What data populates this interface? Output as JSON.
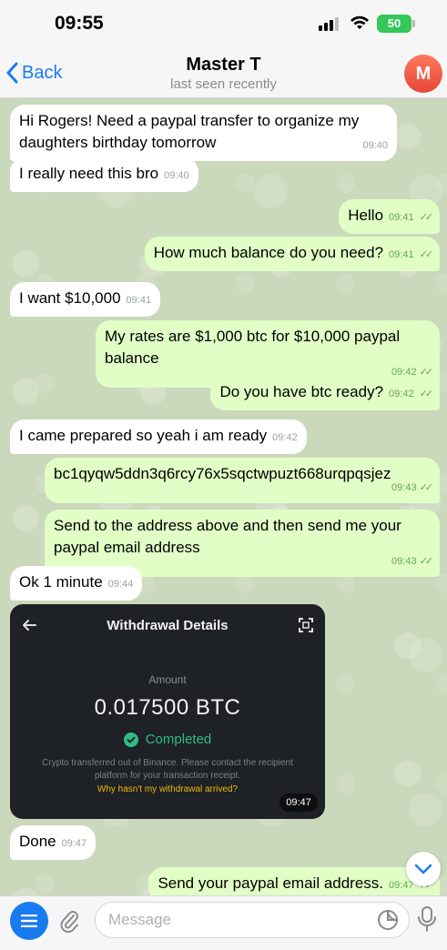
{
  "status_bar": {
    "time": "09:55",
    "battery": "50"
  },
  "header": {
    "back_label": "Back",
    "title": "Master T",
    "subtitle": "last seen recently",
    "avatar_letter": "M"
  },
  "messages": [
    {
      "dir": "in",
      "text": "Hi Rogers! Need a paypal transfer to organize my daughters birthday tomorrow",
      "time": "09:40"
    },
    {
      "dir": "in",
      "text": "I really need this bro",
      "time": "09:40"
    },
    {
      "dir": "out",
      "text": "Hello",
      "time": "09:41"
    },
    {
      "dir": "out",
      "text": "How much balance do you need?",
      "time": "09:41"
    },
    {
      "dir": "in",
      "text": "I want $10,000",
      "time": "09:41"
    },
    {
      "dir": "out",
      "text": "My rates are $1,000 btc for $10,000 paypal balance",
      "time": "09:42"
    },
    {
      "dir": "out",
      "text": "Do you have btc ready?",
      "time": "09:42"
    },
    {
      "dir": "in",
      "text": "I came prepared so yeah i am ready",
      "time": "09:42"
    },
    {
      "dir": "out",
      "text": "bc1qyqw5ddn3q6rcy76x5sqctwpuzt668urqpqsjez",
      "time": "09:43"
    },
    {
      "dir": "out",
      "text": "Send to the address above and then send me your paypal email address",
      "time": "09:43"
    },
    {
      "dir": "in",
      "text": "Ok 1 minute",
      "time": "09:44"
    },
    {
      "dir": "in",
      "text": "Done",
      "time": "09:47"
    },
    {
      "dir": "out",
      "text": "Send your paypal email address.",
      "time": "09:47"
    }
  ],
  "withdrawal_card": {
    "title": "Withdrawal Details",
    "amount_label": "Amount",
    "amount": "0.017500 BTC",
    "status": "Completed",
    "note": "Crypto transferred out of Binance. Please contact the recipient platform for your transaction receipt.",
    "link": "Why hasn't my withdrawal arrived?",
    "time": "09:47"
  },
  "input": {
    "placeholder": "Message"
  },
  "colors": {
    "accent": "#1a7bf0",
    "outgoing_bubble": "#e1fec6",
    "incoming_bubble": "#ffffff",
    "completed": "#2ebd85",
    "warning_link": "#f0b90b"
  }
}
